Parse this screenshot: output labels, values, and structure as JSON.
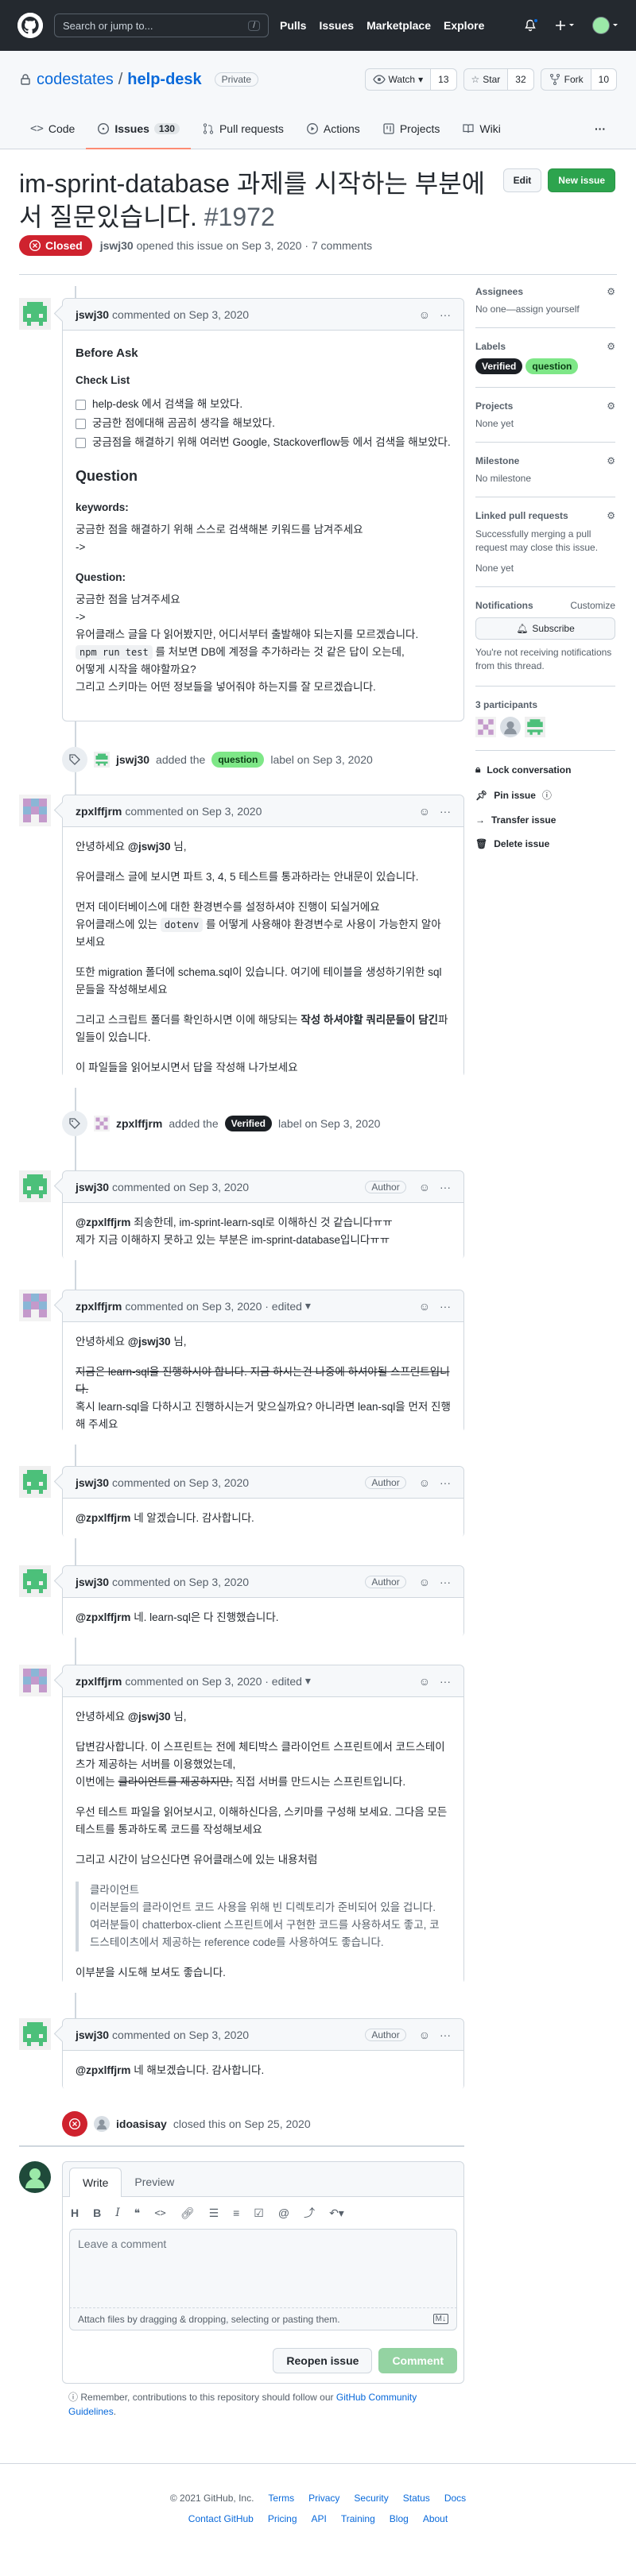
{
  "header": {
    "search_placeholder": "Search or jump to...",
    "slash": "/",
    "nav": [
      "Pulls",
      "Issues",
      "Marketplace",
      "Explore"
    ]
  },
  "repo": {
    "owner": "codestates",
    "sep": "/",
    "name": "help-desk",
    "visibility": "Private",
    "watch_label": "Watch",
    "watch_count": "13",
    "star_label": "Star",
    "star_count": "32",
    "fork_label": "Fork",
    "fork_count": "10"
  },
  "tabs": [
    {
      "label": "Code"
    },
    {
      "label": "Issues",
      "count": "130"
    },
    {
      "label": "Pull requests"
    },
    {
      "label": "Actions"
    },
    {
      "label": "Projects"
    },
    {
      "label": "Wiki"
    }
  ],
  "issue": {
    "title": "im-sprint-database 과제를 시작하는 부분에서 질문있습니다.",
    "number": "#1972",
    "edit_label": "Edit",
    "new_issue_label": "New issue",
    "state": "Closed",
    "author": "jswj30",
    "meta": "opened this issue on Sep 3, 2020 · 7 comments"
  },
  "comments": [
    {
      "author": "jswj30",
      "meta": "commented on Sep 3, 2020",
      "heading": "Before Ask",
      "checklist_title": "Check List",
      "checklist": [
        "help-desk 에서 검색을 해 보았다.",
        "궁금한 점에대해 곰곰히 생각을 해보았다.",
        "궁금점을 해결하기 위해 여러번 Google, Stackoverflow등 에서 검색을 해보았다."
      ],
      "question_heading": "Question",
      "keywords_title": "keywords:",
      "keywords_text": "궁금한 점을 해결하기 위해 스스로 검색해본 키워드를 남겨주세요",
      "keywords_arrow": "->",
      "question_title": "Question:",
      "q_line1": "궁금한 점을 남겨주세요",
      "q_line2": "->",
      "q_line3": "유어클래스 글을 다 읽어봤지만, 어디서부터 출발해야 되는지를 모르겠습니다.",
      "q_code": "npm run test",
      "q_line4": "를 처보면 DB에 계정을 추가하라는 것 같은 답이 오는데,",
      "q_line5": "어떻게 시작을 해야할까요?",
      "q_line6": "그리고 스키마는 어떤 정보들을 넣어줘야 하는지를 잘 모르겠습니다."
    },
    {
      "author": "zpxlffjrm",
      "meta": "commented on Sep 3, 2020",
      "p1a": "안녕하세요",
      "p1m": "@jswj30",
      "p1b": "님,",
      "p2": "유어클래스 글에 보시면 파트 3, 4, 5 테스트를 통과하라는 안내문이 있습니다.",
      "p3a": "먼저 데이터베이스에 대한 환경변수를 설정하셔야 진행이 되실거에요",
      "p3b": "유어클래스에 있는",
      "p3code": "dotenv",
      "p3c": "를 어떻게 사용해야 환경변수로 사용이 가능한지 알아보세요",
      "p4": "또한 migration 폴더에 schema.sql이 있습니다. 여기에 테이블을 생성하기위한 sql문들을 작성해보세요",
      "p5a": "그리고 스크립트 폴더를 확인하시면 이에 해당되는",
      "p5b": "작성 하셔야할 쿼리문들이 담긴",
      "p5c": "파일들이 있습니다.",
      "p6": "이 파일들을 읽어보시면서 답을 작성해 나가보세요"
    },
    {
      "author": "jswj30",
      "meta": "commented on Sep 3, 2020",
      "role": "Author",
      "line1m": "@zpxlffjrm",
      "line1": "죄송한데, im-sprint-learn-sql로 이해하신 것 같습니다ㅠㅠ",
      "line2": "제가 지금 이해하지 못하고 있는 부분은 im-sprint-database입니다ㅠㅠ"
    },
    {
      "author": "zpxlffjrm",
      "meta": "commented on Sep 3, 2020 · edited",
      "p1a": "안녕하세요",
      "p1m": "@jswj30",
      "p1b": "님,",
      "strike": "지금은 learn-sql을 진행하시야 합니다. 지금 하시는건 나중에 하셔야될 스프린트입니다.",
      "p3": "혹시 learn-sql을 다하시고 진행하시는거 맞으실까요? 아니라면 lean-sql을 먼저 진행해 주세요"
    },
    {
      "author": "jswj30",
      "meta": "commented on Sep 3, 2020",
      "role": "Author",
      "m": "@zpxlffjrm",
      "text": "네 알겠습니다. 감사합니다."
    },
    {
      "author": "jswj30",
      "meta": "commented on Sep 3, 2020",
      "role": "Author",
      "m": "@zpxlffjrm",
      "text": "네. learn-sql은 다 진행했습니다."
    },
    {
      "author": "zpxlffjrm",
      "meta": "commented on Sep 3, 2020 · edited",
      "p1a": "안녕하세요",
      "p1m": "@jswj30",
      "p1b": "님,",
      "p2a": "답변감사합니다. 이 스프린트는 전에 체티박스 클라이언트 스프린트에서 코드스테이츠가 제공하는 서버를 이용했었는데,",
      "p2b": "이번에는",
      "p2s": "클라이언트를 제공하지만,",
      "p2c": "직접 서버를 만드시는 스프린트입니다.",
      "p3": "우선 테스트 파일을 읽어보시고, 이해하신다음, 스키마를 구성해 보세요. 그다음 모든 테스트를 통과하도록 코드를 작성해보세요",
      "p4": "그리고 시간이 남으신다면 유어클래스에 있는 내용처럼",
      "q1": "클라이언트",
      "q2": "이러분들의 클라이언트 코드 사용을 위해 빈 디렉토리가 준비되어 있을 겁니다. 여러분들이 chatterbox-client 스프린트에서 구현한 코드를 사용하셔도 좋고, 코드스테이츠에서 제공하는 reference code를 사용하여도 좋습니다.",
      "p5": "이부분을 시도해 보셔도 좋습니다."
    },
    {
      "author": "jswj30",
      "meta": "commented on Sep 3, 2020",
      "role": "Author",
      "m": "@zpxlffjrm",
      "text": "네 해보겠습니다. 감사합니다."
    }
  ],
  "events": [
    {
      "actor": "jswj30",
      "pre": "added the",
      "label": "question",
      "post": "label on Sep 3, 2020"
    },
    {
      "actor": "zpxlffjrm",
      "pre": "added the",
      "label": "Verified",
      "post": "label on Sep 3, 2020"
    },
    {
      "actor": "idoasisay",
      "text": "closed this on Sep 25, 2020"
    }
  ],
  "sidebar": {
    "assignees_title": "Assignees",
    "assignees_value": "No one—assign yourself",
    "labels_title": "Labels",
    "labels": [
      "Verified",
      "question"
    ],
    "projects_title": "Projects",
    "projects_value": "None yet",
    "milestone_title": "Milestone",
    "milestone_value": "No milestone",
    "linked_title": "Linked pull requests",
    "linked_text": "Successfully merging a pull request may close this issue.",
    "linked_value": "None yet",
    "notifications_title": "Notifications",
    "customize": "Customize",
    "subscribe": "Subscribe",
    "notif_text": "You're not receiving notifications from this thread.",
    "participants": "3 participants",
    "actions": [
      "Lock conversation",
      "Pin issue",
      "Transfer issue",
      "Delete issue"
    ]
  },
  "compose": {
    "write": "Write",
    "preview": "Preview",
    "placeholder": "Leave a comment",
    "attach": "Attach files by dragging & dropping, selecting or pasting them.",
    "reopen": "Reopen issue",
    "comment": "Comment"
  },
  "reminder": {
    "text": "Remember, contributions to this repository should follow our",
    "link": "GitHub Community Guidelines",
    "end": "."
  },
  "footer": {
    "copyright": "© 2021 GitHub, Inc.",
    "row1": [
      "Terms",
      "Privacy",
      "Security",
      "Status",
      "Docs"
    ],
    "row2": [
      "Contact GitHub",
      "Pricing",
      "API",
      "Training",
      "Blog",
      "About"
    ]
  },
  "colors": {
    "closed": "#cf222e",
    "accent": "#0969da",
    "green": "#2da44e",
    "question_label": "#7ee787",
    "verified_label": "#1b1f24"
  }
}
